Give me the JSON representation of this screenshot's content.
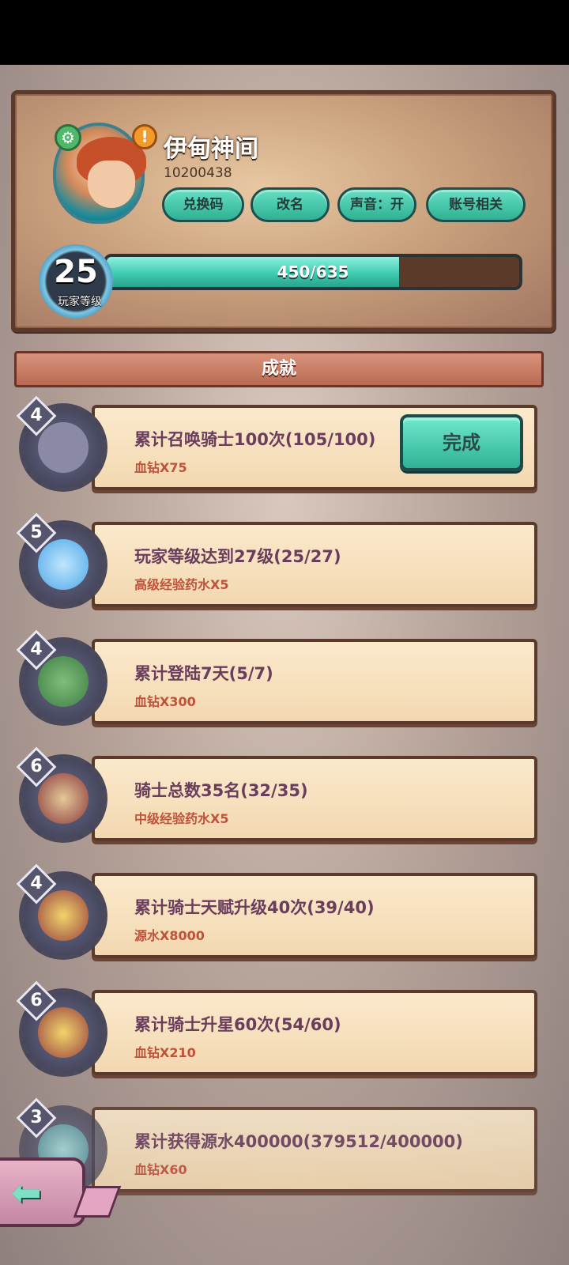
{
  "profile": {
    "name": "伊甸神间",
    "id": "10200438",
    "buttons": [
      "兑换码",
      "改名",
      "声音：开",
      "账号相关"
    ],
    "level": "25",
    "level_label": "玩家等级",
    "xp_text": "450/635",
    "xp_fraction": 0.709
  },
  "section": {
    "title": "成就"
  },
  "achievements": [
    {
      "badge": "4",
      "title": "累计召唤骑士100次(105/100)",
      "reward": "血钻X75",
      "action": "完成"
    },
    {
      "badge": "5",
      "title": "玩家等级达到27级(25/27)",
      "reward": "高级经验药水X5"
    },
    {
      "badge": "4",
      "title": "累计登陆7天(5/7)",
      "reward": "血钻X300"
    },
    {
      "badge": "6",
      "title": "骑士总数35名(32/35)",
      "reward": "中级经验药水X5"
    },
    {
      "badge": "4",
      "title": "累计骑士天赋升级40次(39/40)",
      "reward": "源水X8000"
    },
    {
      "badge": "6",
      "title": "累计骑士升星60次(54/60)",
      "reward": "血钻X210"
    },
    {
      "badge": "3",
      "title": "累计获得源水400000(379512/400000)",
      "reward": "血钻X60"
    }
  ],
  "icons": {
    "settings": "gear-icon",
    "alert": "exclamation-icon",
    "back": "back-arrow-icon"
  },
  "colors": {
    "accent": "#3fcbb0",
    "title_text": "#6a3d5d",
    "reward_text": "#c0523a"
  }
}
